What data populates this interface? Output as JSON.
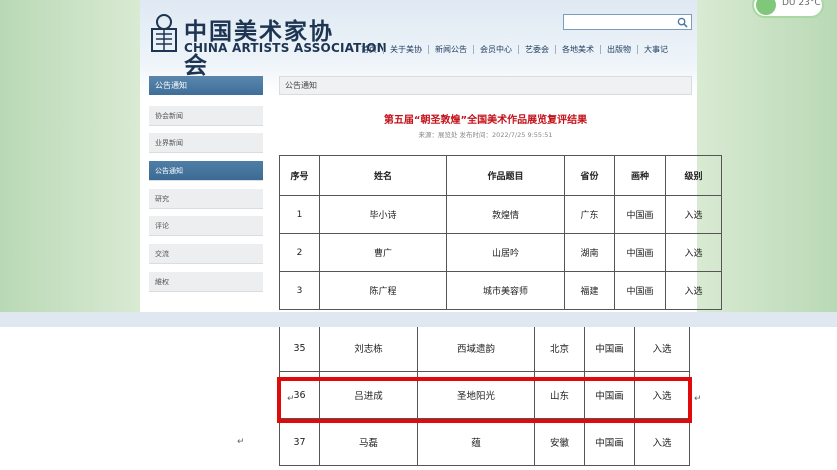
{
  "site": {
    "logo_cn": "中国美术家协会",
    "logo_en": "CHINA ARTISTS ASSOCIATION",
    "search": {
      "placeholder": "",
      "value": ""
    },
    "toggle_label": "DU 23°C",
    "nav": [
      "首页",
      "关于美协",
      "新闻公告",
      "会员中心",
      "艺委会",
      "各地美术",
      "出版物",
      "大事记"
    ]
  },
  "sidebar": {
    "header": "公告通知",
    "items": [
      "协会新闻",
      "业界新闻",
      "公告通知",
      "研究",
      "评论",
      "交流",
      "維权"
    ],
    "active_index": 2
  },
  "content": {
    "header": "公告通知",
    "title": "第五届“朝圣敦煌”全国美术作品展览复评结果",
    "meta": "来源：展览处  发布时间：2022/7/25 9:55:51"
  },
  "table": {
    "headers": [
      "序号",
      "姓名",
      "作品题目",
      "省份",
      "画种",
      "级别"
    ],
    "rows_top": [
      [
        "1",
        "毕小诗",
        "敦煌情",
        "广东",
        "中国画",
        "入选"
      ],
      [
        "2",
        "曹广",
        "山居吟",
        "湖南",
        "中国画",
        "入选"
      ],
      [
        "3",
        "陈广程",
        "城市美容师",
        "福建",
        "中国画",
        "入选"
      ]
    ],
    "rows_bottom": [
      [
        "35",
        "刘志栋",
        "西域遗韵",
        "北京",
        "中国画",
        "入选"
      ],
      [
        "36",
        "吕进成",
        "圣地阳光",
        "山东",
        "中国画",
        "入选"
      ],
      [
        "37",
        "马磊",
        "蕴",
        "安徽",
        "中国画",
        "入选"
      ]
    ],
    "highlighted_row": "36"
  },
  "return_marker": "↵",
  "colors": {
    "accent": "#3e6e99",
    "title_red": "#c4121b",
    "highlight": "#e00a0a"
  }
}
